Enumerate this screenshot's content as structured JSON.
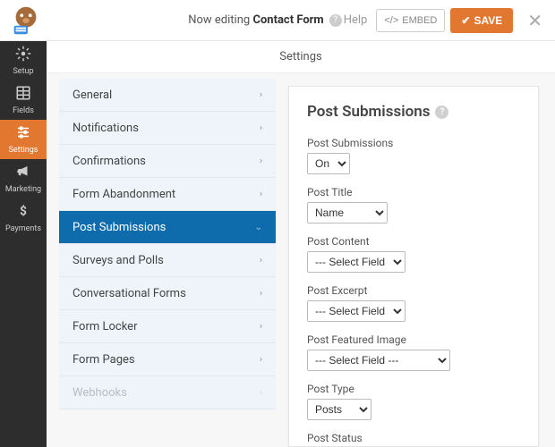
{
  "header": {
    "now_editing_prefix": "Now editing",
    "form_name": "Contact Form",
    "help": "Help",
    "embed": "EMBED",
    "save": "SAVE"
  },
  "leftnav": [
    {
      "label": "Setup",
      "icon": "⚙",
      "active": false
    },
    {
      "label": "Fields",
      "icon": "▦",
      "active": false
    },
    {
      "label": "Settings",
      "icon": "⚙",
      "active": true
    },
    {
      "label": "Marketing",
      "icon": "📣",
      "active": false
    },
    {
      "label": "Payments",
      "icon": "$",
      "active": false
    }
  ],
  "body_header": "Settings",
  "menu": [
    {
      "label": "General"
    },
    {
      "label": "Notifications"
    },
    {
      "label": "Confirmations"
    },
    {
      "label": "Form Abandonment"
    },
    {
      "label": "Post Submissions",
      "active": true
    },
    {
      "label": "Surveys and Polls"
    },
    {
      "label": "Conversational Forms"
    },
    {
      "label": "Form Locker"
    },
    {
      "label": "Form Pages"
    },
    {
      "label": "Webhooks",
      "disabled": true
    }
  ],
  "panel": {
    "title": "Post Submissions",
    "fields": [
      {
        "label": "Post Submissions",
        "value": "On",
        "size": "sm"
      },
      {
        "label": "Post Title",
        "value": "Name",
        "size": "md"
      },
      {
        "label": "Post Content",
        "value": "--- Select Field ---",
        "size": "lg"
      },
      {
        "label": "Post Excerpt",
        "value": "--- Select Field ---",
        "size": "lg"
      },
      {
        "label": "Post Featured Image",
        "value": "--- Select Field ---",
        "size": "xl"
      },
      {
        "label": "Post Type",
        "value": "Posts",
        "size": "mdp"
      },
      {
        "label": "Post Status",
        "value": "",
        "size": "md",
        "noSelect": true
      }
    ]
  }
}
